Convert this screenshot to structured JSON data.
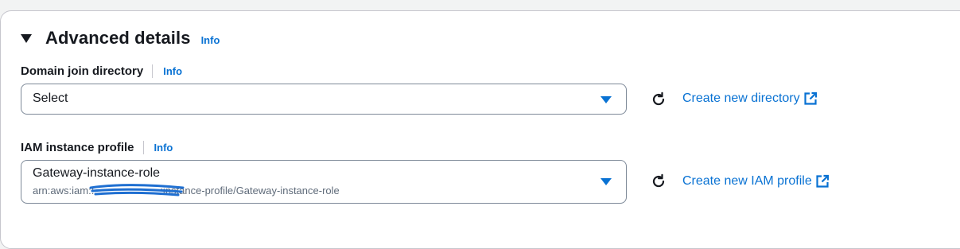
{
  "section": {
    "title": "Advanced details",
    "info": "Info"
  },
  "domain_join": {
    "label": "Domain join directory",
    "info": "Info",
    "value": "Select",
    "create_link": "Create new directory"
  },
  "iam_profile": {
    "label": "IAM instance profile",
    "info": "Info",
    "value": "Gateway-instance-role",
    "arn_prefix": "arn:aws:iam::",
    "arn_suffix": ":instance-profile/Gateway-instance-role",
    "create_link": "Create new IAM profile"
  },
  "colors": {
    "link": "#0972d3",
    "text": "#16191f",
    "border": "#7d8998",
    "redaction": "#1f6fd1"
  },
  "icons": [
    "caret-down-icon",
    "dropdown-arrow-icon",
    "refresh-icon",
    "external-link-icon"
  ]
}
